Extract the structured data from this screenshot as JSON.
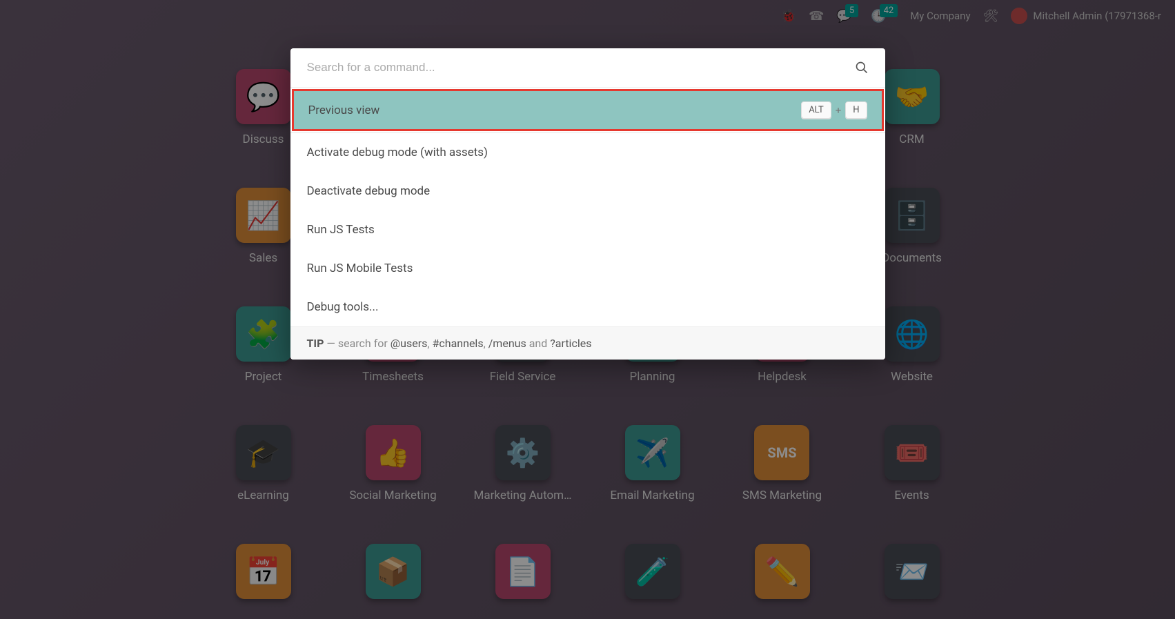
{
  "navbar": {
    "chat_badge": "5",
    "clock_badge": "42",
    "company": "My Company",
    "user": "Mitchell Admin (17971368-r"
  },
  "apps": [
    {
      "label": "Discuss",
      "color": "c-red",
      "glyph": "💬"
    },
    {
      "label": "",
      "color": "",
      "glyph": ""
    },
    {
      "label": "",
      "color": "",
      "glyph": ""
    },
    {
      "label": "",
      "color": "",
      "glyph": ""
    },
    {
      "label": "",
      "color": "",
      "glyph": ""
    },
    {
      "label": "CRM",
      "color": "c-teal",
      "glyph": "🤝"
    },
    {
      "label": "Sales",
      "color": "c-orange",
      "glyph": "📈"
    },
    {
      "label": "",
      "color": "",
      "glyph": ""
    },
    {
      "label": "",
      "color": "",
      "glyph": ""
    },
    {
      "label": "",
      "color": "",
      "glyph": ""
    },
    {
      "label": "",
      "color": "",
      "glyph": ""
    },
    {
      "label": "Documents",
      "color": "c-dark",
      "glyph": "🗄️"
    },
    {
      "label": "Project",
      "color": "c-teal",
      "glyph": "🧩"
    },
    {
      "label": "Timesheets",
      "color": "c-red",
      "glyph": "🕒"
    },
    {
      "label": "Field Service",
      "color": "c-dark",
      "glyph": "⏱️"
    },
    {
      "label": "Planning",
      "color": "c-teal",
      "glyph": "📋"
    },
    {
      "label": "Helpdesk",
      "color": "c-red",
      "glyph": "🛟"
    },
    {
      "label": "Website",
      "color": "c-dark",
      "glyph": "🌐"
    },
    {
      "label": "eLearning",
      "color": "c-dark",
      "glyph": "🎓"
    },
    {
      "label": "Social Marketing",
      "color": "c-red",
      "glyph": "👍"
    },
    {
      "label": "Marketing Autom…",
      "color": "c-dark",
      "glyph": "⚙️"
    },
    {
      "label": "Email Marketing",
      "color": "c-teal",
      "glyph": "✈️"
    },
    {
      "label": "SMS Marketing",
      "color": "c-orange",
      "glyph": "SMS"
    },
    {
      "label": "Events",
      "color": "c-dark",
      "glyph": "🎟️"
    },
    {
      "label": "",
      "color": "c-orange",
      "glyph": "📅"
    },
    {
      "label": "",
      "color": "c-teal",
      "glyph": "📦"
    },
    {
      "label": "",
      "color": "c-red",
      "glyph": "📄"
    },
    {
      "label": "",
      "color": "c-dark",
      "glyph": "🧪"
    },
    {
      "label": "",
      "color": "c-orange",
      "glyph": "✏️"
    },
    {
      "label": "",
      "color": "c-dark",
      "glyph": "📨"
    }
  ],
  "palette": {
    "placeholder": "Search for a command...",
    "items": [
      {
        "label": "Previous view",
        "key1": "ALT",
        "key2": "H",
        "selected": true
      },
      {
        "label": "Activate debug mode (with assets)"
      },
      {
        "label": "Deactivate debug mode"
      },
      {
        "label": "Run JS Tests"
      },
      {
        "label": "Run JS Mobile Tests"
      },
      {
        "label": "Debug tools..."
      }
    ],
    "tip_label": "TIP",
    "tip_dash": " — search for ",
    "tip_users": "@users",
    "tip_c1": ", ",
    "tip_channels": "#channels",
    "tip_c2": ", ",
    "tip_menus": "/menus",
    "tip_and": " and ",
    "tip_articles": "?articles"
  }
}
